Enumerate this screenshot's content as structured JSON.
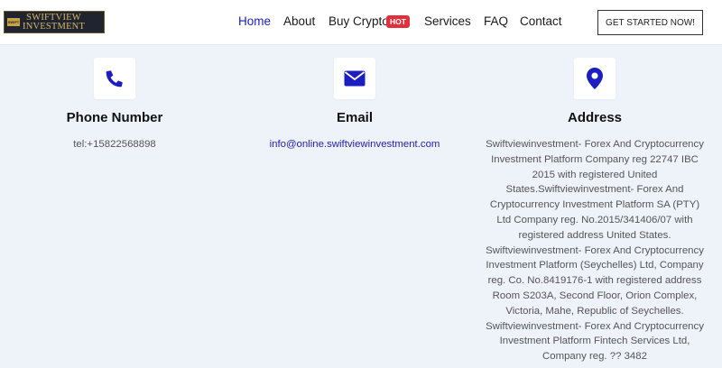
{
  "header": {
    "logo": {
      "badge": "SWIFT",
      "line1": "SWIFTVIEW",
      "line2": "INVESTMENT"
    },
    "nav": [
      {
        "label": "Home"
      },
      {
        "label": "About"
      },
      {
        "label": "Buy Crypto",
        "badge": "HOT"
      },
      {
        "label": "Services"
      },
      {
        "label": "FAQ"
      },
      {
        "label": "Contact"
      }
    ],
    "cta_label": "GET STARTED NOW!"
  },
  "contact": {
    "phone": {
      "icon": "phone-icon",
      "title": "Phone Number",
      "value": "tel:+15822568898"
    },
    "email": {
      "icon": "envelope-icon",
      "title": "Email",
      "value": "info@online.swiftviewinvestment.com"
    },
    "address": {
      "icon": "map-pin-icon",
      "title": "Address",
      "value": "Swiftviewinvestment- Forex And Cryptocurrency Investment Platform Company reg 22747 IBC 2015 with registered United States.Swiftviewinvestment- Forex And Cryptocurrency Investment Platform SA (PTY) Ltd Company reg. No.2015/341406/07 with registered address United States. Swiftviewinvestment- Forex And Cryptocurrency Investment Platform (Seychelles) Ltd, Company reg. Co. No.8419176-1 with registered address Room S203A, Second Floor, Orion Complex, Victoria, Mahe, Republic of Seychelles. Swiftviewinvestment- Forex And Cryptocurrency Investment Platform Fintech Services Ltd, Company reg. ?? 3482"
    }
  },
  "colors": {
    "accent": "#1d1ec1",
    "hot": "#e0303c",
    "background": "#eef2f9"
  }
}
